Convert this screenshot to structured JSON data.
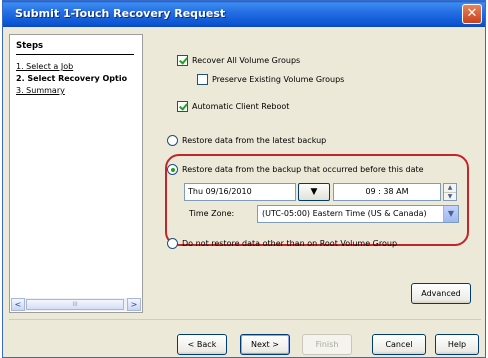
{
  "window": {
    "title": "Submit 1-Touch Recovery Request",
    "close_glyph": "✕"
  },
  "sidebar": {
    "heading": "Steps",
    "items": [
      {
        "label": "1. Select a Job"
      },
      {
        "label": "2. Select Recovery Optio"
      },
      {
        "label": "3. Summary"
      }
    ],
    "scroll_left": "<",
    "scroll_right": ">",
    "scroll_grip": "III"
  },
  "options": {
    "recover_all": "Recover All Volume Groups",
    "preserve_existing": "Preserve Existing Volume Groups",
    "auto_reboot": "Automatic Client Reboot",
    "restore_latest": "Restore data from the latest backup",
    "restore_before": "Restore data from the backup that occurred before this date",
    "no_restore": "Do not restore data other than on Root Volume Group"
  },
  "datetime": {
    "date": "Thu 09/16/2010",
    "time": "09 : 38 AM",
    "timezone_label": "Time Zone:",
    "timezone_value": "(UTC-05:00) Eastern Time (US & Canada)"
  },
  "buttons": {
    "advanced": "Advanced",
    "back": "< Back",
    "next": "Next >",
    "finish": "Finish",
    "cancel": "Cancel",
    "help": "Help"
  },
  "colors": {
    "highlight": "#c2262a",
    "titlebar": "#0c55d3",
    "check": "#21a121"
  }
}
